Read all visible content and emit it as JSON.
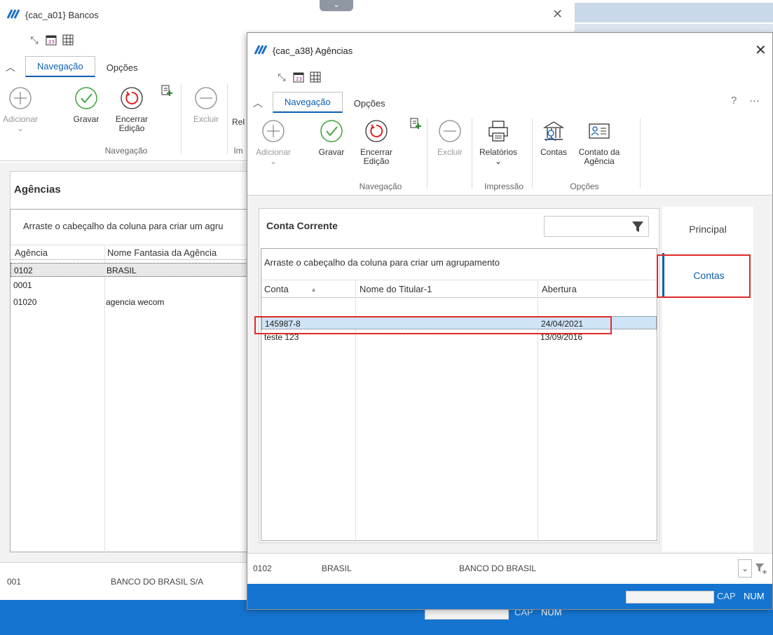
{
  "bg_window": {
    "title": "{cac_a01} Bancos",
    "tabs": [
      "Navegação",
      "Opções"
    ],
    "ribbon": {
      "adicionar": "Adicionar",
      "gravar": "Gravar",
      "encerrar_line1": "Encerrar",
      "encerrar_line2": "Edição",
      "excluir": "Excluir",
      "relatorios_partial": "Rel",
      "group_navegacao": "Navegação",
      "group_impressao_partial": "Im"
    },
    "panel_title": "Agências",
    "grid": {
      "hint": "Arraste o cabeçalho da coluna para criar um agru",
      "columns": [
        "Agência",
        "Nome Fantasia da Agência"
      ],
      "rows": [
        {
          "agencia": "0102",
          "nome": "BRASIL"
        },
        {
          "agencia": "0001",
          "nome": ""
        },
        {
          "agencia": "01020",
          "nome": "agencia wecom"
        }
      ]
    },
    "footer": {
      "code": "001",
      "name": "BANCO DO BRASIL S/A"
    },
    "status": {
      "cap": "CAP",
      "num": "NUM"
    }
  },
  "fg_window": {
    "title": "{cac_a38} Agências",
    "tabs": [
      "Navegação",
      "Opções"
    ],
    "help": "?",
    "more": "···",
    "ribbon": {
      "adicionar": "Adicionar",
      "gravar": "Gravar",
      "encerrar_line1": "Encerrar",
      "encerrar_line2": "Edição",
      "excluir": "Excluir",
      "relatorios": "Relatórios",
      "contas": "Contas",
      "contato_line1": "Contato da",
      "contato_line2": "Agência",
      "group_navegacao": "Navegação",
      "group_impressao": "Impressão",
      "group_opcoes": "Opções"
    },
    "panel_title": "Conta Corrente",
    "search": {
      "value": "",
      "placeholder": ""
    },
    "grid": {
      "hint": "Arraste o cabeçalho da coluna para criar um agrupamento",
      "columns": [
        "Conta",
        "Nome do Titular-1",
        "Abertura"
      ],
      "sort_indicator": "▲",
      "rows": [
        {
          "conta": "145987-8",
          "titular": "",
          "abertura": "24/04/2021"
        },
        {
          "conta": "teste 123",
          "titular": "",
          "abertura": "13/09/2016"
        }
      ]
    },
    "side_tabs": [
      "Principal",
      "Contas"
    ],
    "footer": {
      "code": "0102",
      "name": "BRASIL",
      "bank": "BANCO DO BRASIL"
    },
    "status": {
      "cap": "CAP",
      "num": "NUM"
    }
  },
  "colors": {
    "accent": "#0c5fb3",
    "statusbar": "#1474cf",
    "highlight": "#e02a2a",
    "selected_row": "#cfe4f6"
  }
}
